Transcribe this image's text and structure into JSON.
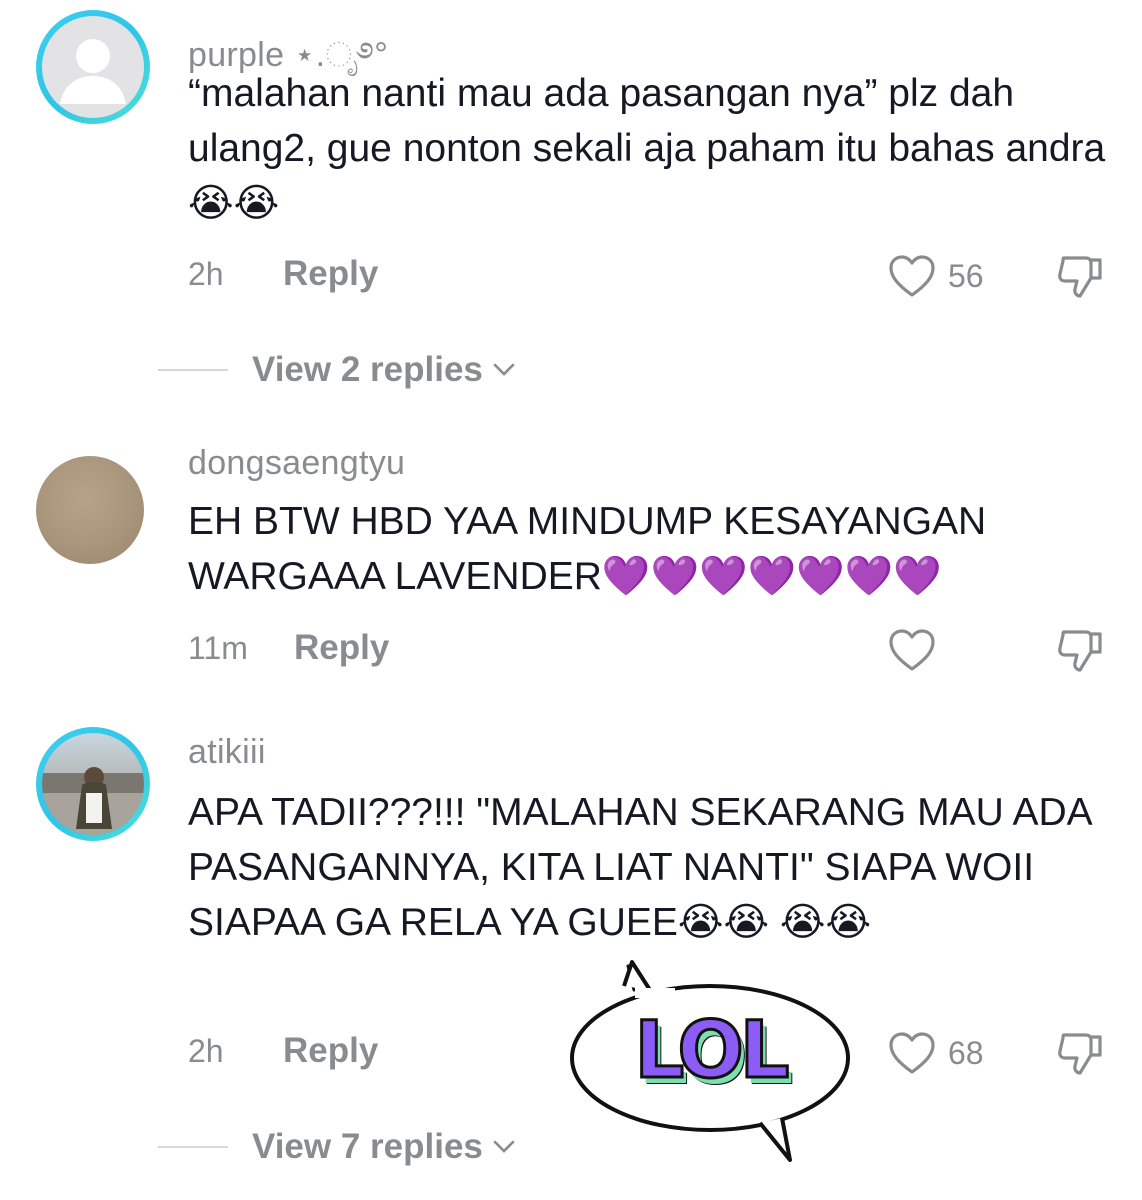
{
  "comments": [
    {
      "username": "purple ⋆.ೃ࿔°",
      "text": "“malahan nanti mau ada pasangan nya” plz dah ulang2, gue nonton sekali aja paham itu bahas andra 😭😭",
      "time": "2h",
      "reply": "Reply",
      "likes": "56",
      "view_replies": "View 2 replies"
    },
    {
      "username": "dongsaengtyu",
      "text": "EH BTW HBD YAA MINDUMP KESAYANGAN WARGAAA LAVENDER💜💜💜💜💜💜💜",
      "time": "11m",
      "reply": "Reply",
      "likes": ""
    },
    {
      "username": "atikiii",
      "text": "APA TADII???!!! \"MALAHAN SEKARANG MAU ADA PASANGANNYA, KITA LIAT NANTI\" SIAPA WOII SIAPAA GA RELA YA GUEE😭😭 😭😭",
      "time": "2h",
      "reply": "Reply",
      "likes": "68",
      "view_replies": "View 7 replies"
    }
  ],
  "sticker": {
    "text": "LOL",
    "fill": "#8b5cf6",
    "shadow": "#7be0b0"
  },
  "colors": {
    "muted": "#8a8b91",
    "ring": "#2ec5e8"
  }
}
